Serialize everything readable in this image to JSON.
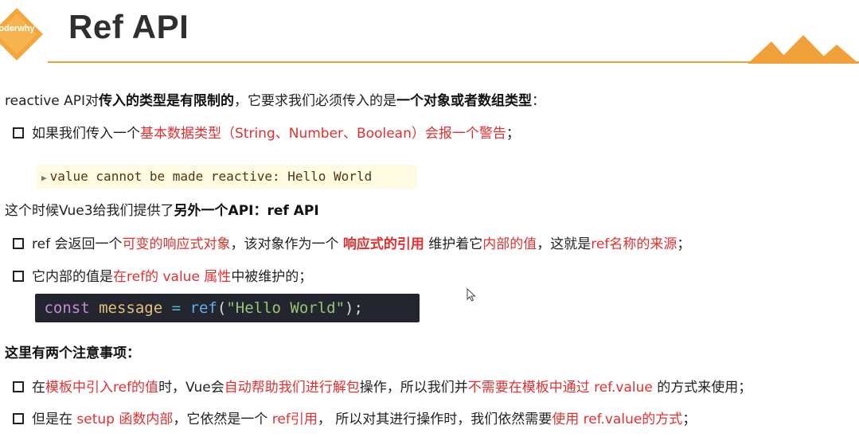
{
  "logo": {
    "text": "oderwhy"
  },
  "title": "Ref API",
  "intro": {
    "t1": "reactive API对",
    "b1": "传入的类型是有限制的",
    "t2": "，它要求我们必须传入的是",
    "b2": "一个对象或者数组类型",
    "t3": "："
  },
  "warn_item": {
    "t1": "如果我们传入一个",
    "r1": "基本数据类型（String、Number、Boolean）会报一个警告",
    "t2": "；"
  },
  "console_warning": "value cannot be made reactive: Hello World",
  "provide_line": {
    "t1": "这个时候Vue3给我们提供了",
    "b1": "另外一个API：ref API"
  },
  "ref_item1": {
    "t1": "ref 会返回一个",
    "r1": "可变的响应式对象",
    "t2": "，该对象作为一个 ",
    "rb1": "响应式的引用",
    "t3": " 维护着它",
    "r2": "内部的值",
    "t4": "，这就是",
    "r3": "ref名称的来源",
    "t5": "；"
  },
  "ref_item2": {
    "t1": "它内部的值是",
    "r1": "在ref的 value 属性",
    "t2": "中被维护的；"
  },
  "code": {
    "kw": "const",
    "name": "message",
    "eq": "=",
    "fn": "ref",
    "open": "(",
    "str": "\"Hello World\"",
    "close": ");"
  },
  "notes_heading": "这里有两个注意事项：",
  "note1": {
    "t1": "在",
    "r1": "模板中引入ref的值",
    "t2": "时，Vue会",
    "r2": "自动帮助我们进行解包",
    "t3": "操作，所以我们并",
    "r3": "不需要在模板中通过 ref.value",
    "t4": " 的方式来使用；"
  },
  "note2": {
    "t1": "但是在 ",
    "r1": "setup 函数内部",
    "t2": "，它依然是一个 ",
    "r2": "ref引用",
    "t3": "， 所以对其进行操作时，我们依然需要",
    "r3": "使用 ref.value的方式",
    "t4": "；"
  },
  "colors": {
    "accent": "#e8a23a",
    "emphasis_red": "#e23030",
    "code_bg": "#23262e",
    "warn_bg": "#fffbe2"
  }
}
